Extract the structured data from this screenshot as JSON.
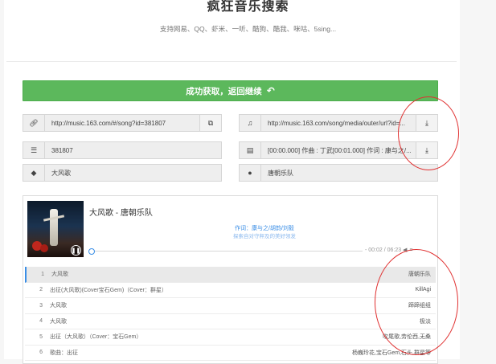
{
  "header": {
    "title": "疯狂音乐搜索",
    "subtitle": "支持网易、QQ、虾米、一听、酷狗、酷我、咪咕、5sing..."
  },
  "success_button": {
    "label": "成功获取，返回继续",
    "icon": "undo-icon"
  },
  "fields": {
    "link": {
      "icon": "link-icon",
      "value": "http://music.163.com/#/song?id=381807",
      "action_icon": "external-link-icon"
    },
    "audio_url": {
      "icon": "music-icon",
      "value": "http://music.163.com/song/media/outer/url?id=...",
      "action_icon": "download-icon"
    },
    "song_id": {
      "icon": "list-icon",
      "value": "381807"
    },
    "lyrics": {
      "icon": "file-icon",
      "value": "[00:00.000] 作曲 : 丁武[00:01.000] 作词 : 康与之/...",
      "action_icon": "download-icon"
    },
    "song_name": {
      "icon": "tag-icon",
      "value": "大风歌"
    },
    "artist": {
      "icon": "user-icon",
      "value": "唐朝乐队"
    }
  },
  "player": {
    "song_title": "大风歌 - 唐朝乐队",
    "lyric_line1": "作词：康与之/胡韵/刘毅",
    "lyric_line2": "探索自对守秤及的美好领发",
    "time": "- 00:02 / 06:23",
    "progress": 0.005,
    "pause_icon": "pause-icon",
    "controls": [
      "volume-icon",
      "menu-icon"
    ]
  },
  "playlist": [
    {
      "num": "1",
      "name": "大风歌",
      "artist": "唐朝乐队"
    },
    {
      "num": "2",
      "name": "出征(大风歌)(Cover宝石Gem)（Cover：群星）",
      "artist": "KillAgi"
    },
    {
      "num": "3",
      "name": "大风歌",
      "artist": "蹄蹄组组"
    },
    {
      "num": "4",
      "name": "大风歌",
      "artist": "极淡"
    },
    {
      "num": "5",
      "name": "出征（大风歌）（Cover：宝石Gem）",
      "artist": "吹尾歌,劳伦西,无桑"
    },
    {
      "num": "6",
      "name": "歌曲：出征",
      "artist": "杨巍玲花,宝石Gem,石头,群星等"
    }
  ],
  "colors": {
    "accent": "#5cb85c",
    "highlight": "#3a8ee6",
    "annotation": "#e03030"
  }
}
